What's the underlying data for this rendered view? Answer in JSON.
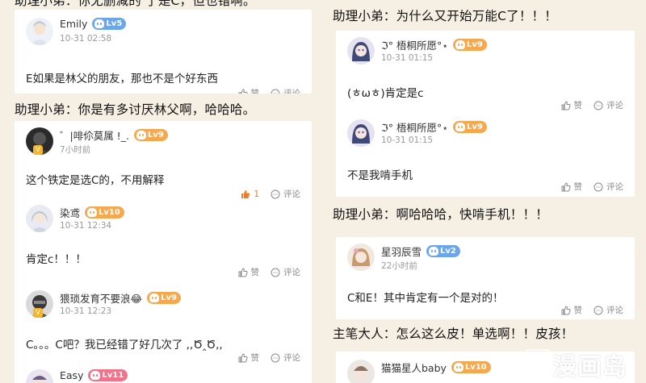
{
  "left_column": {
    "top_caption_partial": "助理小弟：你无删减的 了是C，但也错啊。",
    "card1": {
      "user": "Emily",
      "level": "Lv5",
      "time": "10-31 02:58",
      "text": "E如果是林父的朋友，那也不是个好东西",
      "like": "赞",
      "comment": "评论"
    },
    "caption2": "助理小弟：你是有多讨厌林父啊，哈哈哈。",
    "card2": {
      "c1": {
        "user": "゛|啡伱莫属 !_.",
        "level": "Lv9",
        "time": "7小时前",
        "text": "这个铁定是选C的，不用解释",
        "likes": "1",
        "comment": "评论"
      },
      "c2": {
        "user": "染鸢",
        "level": "Lv10",
        "time": "10-31 12:34",
        "text": "肯定c！！！",
        "like": "赞",
        "comment": "评论"
      },
      "c3": {
        "user": "猥琐发育不要浪😂",
        "level": "Lv9",
        "time": "10-31 12:23",
        "text": "C。。。C吧？我已经错了好几次了 ,,Ծ‸Ծ,,",
        "like": "赞",
        "comment": "评论"
      },
      "c4": {
        "user": "Easy",
        "level": "Lv11"
      }
    }
  },
  "right_column": {
    "caption1": "助理小弟：为什么又开始万能C了！！！",
    "card1": {
      "c1": {
        "user": "ℑ° 梧桐所愿°⋆",
        "level": "Lv9",
        "time": "10-31 01:15",
        "text": "(ㅎωㅎ)肯定是c",
        "like": "赞",
        "comment": "评论"
      },
      "c2": {
        "user": "ℑ° 梧桐所愿°⋆",
        "level": "Lv9",
        "time": "10-31 01:15",
        "text": "不是我啃手机",
        "like": "赞",
        "comment": "评论"
      }
    },
    "caption2": "助理小弟：啊哈哈哈，快啃手机！！！",
    "card2": {
      "user": "星羽辰雪",
      "level": "Lv2",
      "time": "22小时前",
      "text": "C和E！其中肯定有一个是对的！",
      "like": "赞",
      "comment": "评论"
    },
    "caption3": "主笔大人：怎么这么皮！单选啊！！皮孩！",
    "card3": {
      "user": "猫猫星人baby",
      "level": "Lv10"
    }
  },
  "watermark": {
    "box": "M",
    "text": "漫画岛"
  },
  "icons": {
    "like": "thumbs-up-icon",
    "comment": "comment-bubble-icon",
    "level": "cat-face-icon"
  },
  "colors": {
    "background": "#f6efe4",
    "level_blue": "#6aa6e8",
    "level_orange": "#f6a84e",
    "level_pink": "#f0738a",
    "liked": "#f07a28"
  }
}
